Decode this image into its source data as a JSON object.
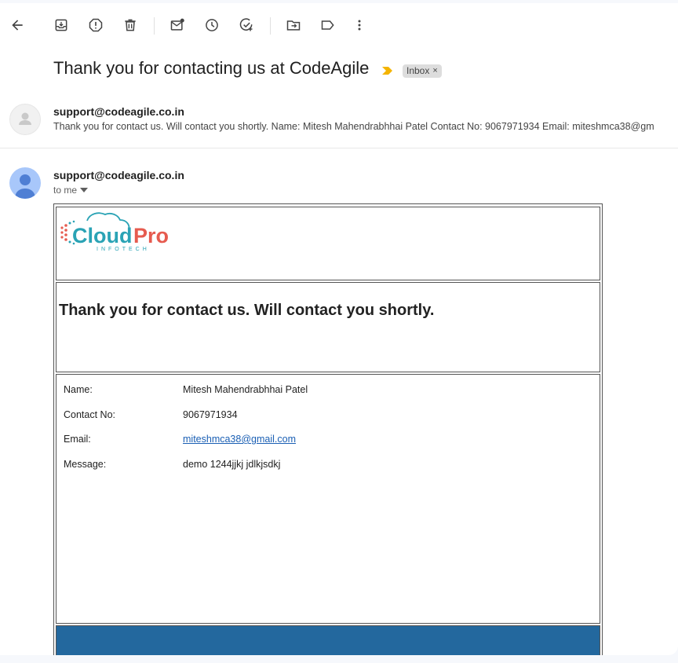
{
  "toolbar": {
    "icons": [
      "back-arrow-icon",
      "archive-icon",
      "report-spam-icon",
      "delete-icon",
      "mark-unread-icon",
      "snooze-icon",
      "add-task-icon",
      "move-to-icon",
      "label-icon",
      "more-vert-icon"
    ]
  },
  "header": {
    "subject": "Thank you for contacting us at CodeAgile",
    "label": "Inbox",
    "label_close": "×"
  },
  "collapsed_message": {
    "sender": "support@codeagile.co.in",
    "snippet": "Thank you for contact us. Will contact you shortly. Name: Mitesh Mahendrabhhai Patel Contact No: 9067971934 Email: miteshmca38@gm"
  },
  "expanded_message": {
    "sender": "support@codeagile.co.in",
    "recipient_line": "to me"
  },
  "email_body": {
    "logo": {
      "main": "CloudPro",
      "sub": "INFOTECH"
    },
    "heading": "Thank you for contact us. Will contact you shortly.",
    "fields": [
      {
        "label": "Name:",
        "value": "Mitesh Mahendrabhhai Patel"
      },
      {
        "label": "Contact No:",
        "value": "9067971934"
      },
      {
        "label": "Email:",
        "value": "miteshmca38@gmail.com",
        "is_link": true
      },
      {
        "label": "Message:",
        "value": "demo 1244jjkj jdlkjsdkj"
      }
    ]
  },
  "colors": {
    "footer_band": "#23689e",
    "logo_teal": "#2aa3b5",
    "logo_red": "#e65b4f",
    "importance_marker": "#f4b400"
  }
}
